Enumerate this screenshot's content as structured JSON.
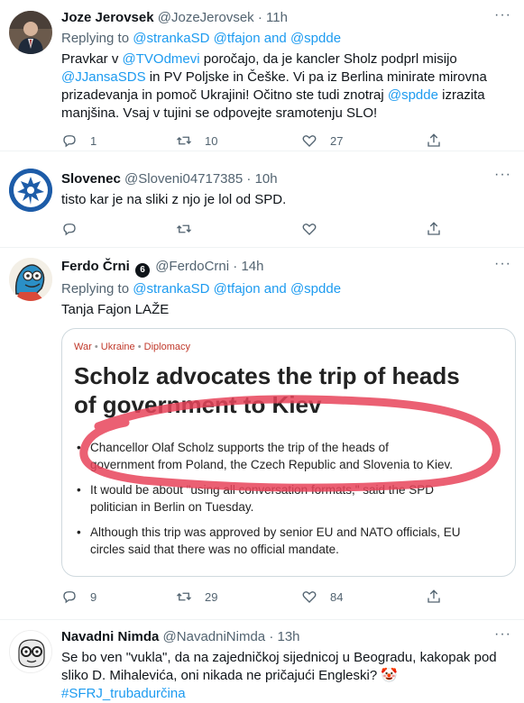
{
  "tweets": [
    {
      "name": "Joze Jerovsek",
      "handle": "@JozeJerovsek",
      "time": "11h",
      "reply_prefix": "Replying to",
      "reply_user1": "@strankaSD",
      "reply_user2": "@tfajon",
      "reply_and": "and",
      "reply_user3": "@spdde",
      "text_parts": {
        "p1": "Pravkar v ",
        "m1": "@TVOdmevi",
        "p2": " poročajo, da je kancler Sholz podprl misijo",
        "m2": "@JJansaSDS",
        "p3": " in PV Poljske in Češke. Vi pa iz Berlina minirate mirovna",
        "p4": "prizadevanja in pomoč Ukrajini! Očitno ste tudi znotraj ",
        "m3": "@spdde",
        "p5": " izrazita",
        "p6": "manjšina. Vsaj v tujini se odpovejte sramotenju SLO!"
      },
      "replies": "1",
      "retweets": "10",
      "likes": "27"
    },
    {
      "name": "Slovenec",
      "handle": "@Sloveni04717385",
      "time": "10h",
      "text": "tisto kar je na sliki z njo je lol od SPD.",
      "replies": "",
      "retweets": "",
      "likes": ""
    },
    {
      "name": "Ferdo Črni",
      "badge": "6",
      "handle": "@FerdoCrni",
      "time": "14h",
      "reply_prefix": "Replying to",
      "reply_user1": "@strankaSD",
      "reply_user2": "@tfajon",
      "reply_and": "and",
      "reply_user3": "@spdde",
      "text": "Tanja Fajon LAŽE",
      "replies": "9",
      "retweets": "29",
      "likes": "84"
    },
    {
      "name": "Navadni Nimda",
      "handle": "@NavadniNimda",
      "time": "13h",
      "text_line1": "Se bo ven \"vukla\", da na zajedničkoj sijednicoj u Beogradu, kakopak pod",
      "text_line2": "sliko D. Mihalevića, oni nikada ne pričajući Engleski? 🤡",
      "hashtag": "#SFRJ_trubadurčina"
    }
  ],
  "dot": "·",
  "more_label": "···",
  "article": {
    "breadcrumb": [
      "War",
      "Ukraine",
      "Diplomacy"
    ],
    "bullet_sep": "•",
    "headline_line1": "Scholz advocates the trip of heads",
    "headline_line2": "of government to Kiev",
    "bullets": [
      [
        "Chancellor Olaf Scholz supports the trip of the heads of",
        "government from Poland, the Czech Republic and Slovenia to Kiev."
      ],
      [
        "It would be about \"using all conversation formats,\" said the SPD",
        "politician in Berlin on Tuesday."
      ],
      [
        "Although this trip was approved by senior EU and NATO officials, EU",
        "circles said that there was no official mandate."
      ]
    ],
    "highlight_color": "#e8445a"
  },
  "colors": {
    "accent": "#1d9bf0",
    "muted": "#536471",
    "text": "#0f1419",
    "border": "#eff3f4"
  }
}
